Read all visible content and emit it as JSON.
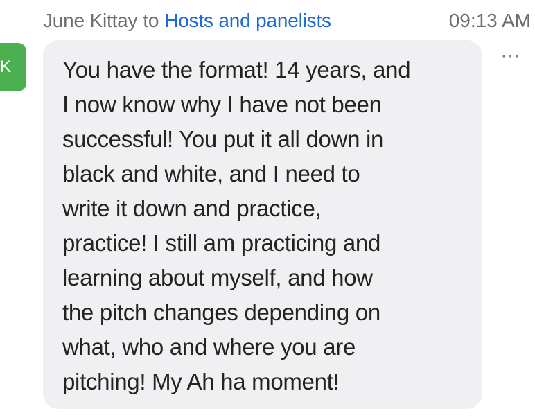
{
  "message": {
    "avatar_initial": "K",
    "sender": "June Kittay",
    "to_word": "to",
    "recipient": "Hosts and panelists",
    "timestamp": "09:13 AM",
    "more_label": "···",
    "text": "You have the format! 14 years, and\nI now know why I have not been\nsuccessful! You put it all down in\nblack and white, and I need to\nwrite it down and practice,\npractice! I still am practicing and\nlearning about myself, and how\nthe pitch changes depending on\nwhat, who and where you are\npitching! My Ah ha moment!"
  },
  "colors": {
    "avatar_bg": "#4caf50",
    "recipient_link": "#1e6bd6",
    "bubble_bg": "#f0f0f3",
    "meta_text": "#6e6e6e"
  },
  "icons": {
    "more": "more-options-icon"
  }
}
